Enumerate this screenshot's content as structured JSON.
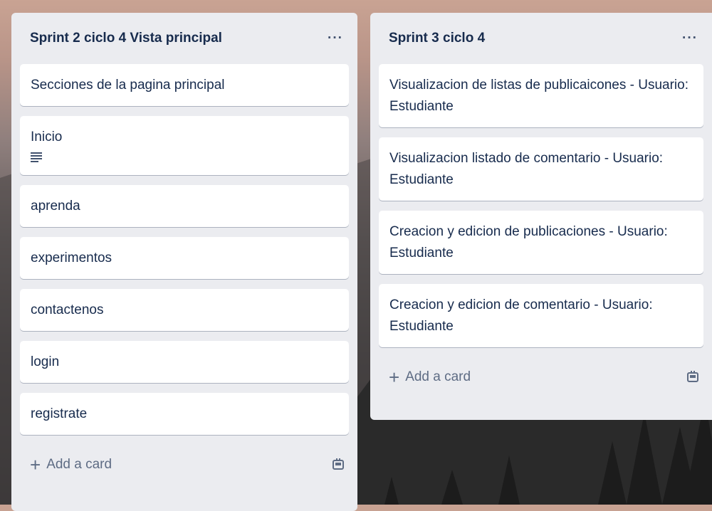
{
  "lists": [
    {
      "title": "Sprint 2 ciclo 4 Vista principal",
      "menu_label": "···",
      "cards": [
        {
          "text": "Secciones de la pagina principal"
        },
        {
          "text": "Inicio",
          "has_description": true
        },
        {
          "text": "aprenda"
        },
        {
          "text": "experimentos"
        },
        {
          "text": "contactenos"
        },
        {
          "text": "login"
        },
        {
          "text": "registrate"
        }
      ],
      "add_card_label": "Add a card",
      "add_card_icon": "plus-icon",
      "template_icon": "card-template-icon"
    },
    {
      "title": "Sprint 3 ciclo 4",
      "menu_label": "···",
      "cards": [
        {
          "text": "Visualizacion de listas de publicaicones - Usuario: Estudiante"
        },
        {
          "text": "Visualizacion listado de comentario - Usuario: Estudiante"
        },
        {
          "text": "Creacion y edicion de publicaciones - Usuario: Estudiante"
        },
        {
          "text": "Creacion y edicion de comentario - Usuario: Estudiante"
        }
      ],
      "add_card_label": "Add a card",
      "add_card_icon": "plus-icon",
      "template_icon": "card-template-icon"
    }
  ],
  "colors": {
    "list_bg": "#ebecf0",
    "card_bg": "#ffffff",
    "text": "#172b4d",
    "muted": "#5e6c84"
  }
}
